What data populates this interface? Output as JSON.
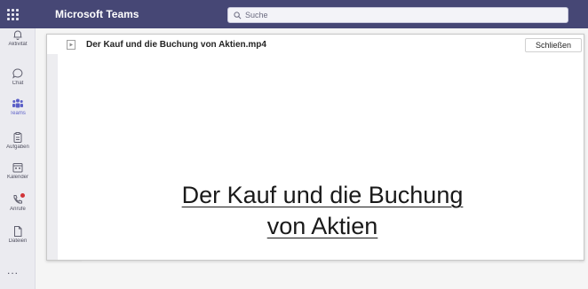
{
  "app": {
    "title": "Microsoft Teams",
    "search_placeholder": "Suche",
    "colors": {
      "titlebar": "#464775",
      "accent": "#5b5fc7",
      "notification": "#d13438"
    }
  },
  "rail": {
    "items": [
      {
        "label": "Aktivität",
        "icon": "bell-icon",
        "active": false
      },
      {
        "label": "Chat",
        "icon": "chat-icon",
        "active": false
      },
      {
        "label": "Teams",
        "icon": "teams-icon",
        "active": true
      },
      {
        "label": "Aufgaben",
        "icon": "clipboard-icon",
        "active": false
      },
      {
        "label": "Kalender",
        "icon": "calendar-icon",
        "active": false
      },
      {
        "label": "Anrufe",
        "icon": "phone-icon",
        "active": false,
        "notification_dot": true
      },
      {
        "label": "Dateien",
        "icon": "file-icon",
        "active": false
      }
    ],
    "more": "..."
  },
  "viewer": {
    "file_name": "Der Kauf und die Buchung von Aktien.mp4",
    "close_label": "Schließen",
    "slide_title_line1": "Der Kauf und die Buchung",
    "slide_title_line2": "von Aktien"
  }
}
